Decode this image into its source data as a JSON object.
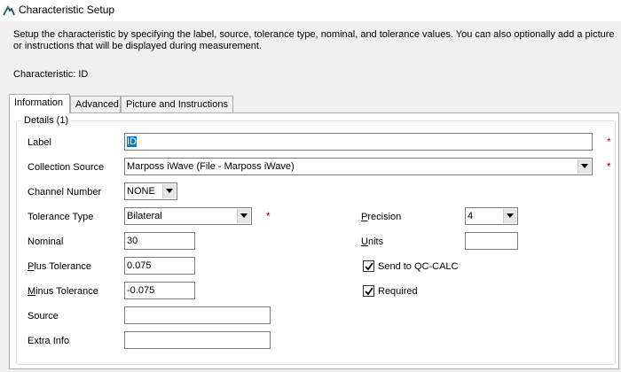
{
  "window": {
    "title": "Characteristic Setup"
  },
  "description": "Setup the characteristic by specifying the label, source, tolerance type, nominal, and tolerance values. You can also optionally add a picture or instructions that will be displayed during measurement.",
  "characteristic_line": "Characteristic: ID",
  "tabs": [
    {
      "label": "Information",
      "active": true
    },
    {
      "label": "Advanced",
      "active": false
    },
    {
      "label": "Picture and Instructions",
      "active": false
    }
  ],
  "details": {
    "group_label": "Details (1)",
    "label": {
      "caption": "Label",
      "value": "ID"
    },
    "collection_source": {
      "caption": "Collection Source",
      "value": "Marposs iWave (File - Marposs iWave)"
    },
    "channel_number": {
      "caption": "Channel Number",
      "value": "NONE"
    },
    "tolerance_type": {
      "caption": "Tolerance Type",
      "value": "Bilateral"
    },
    "nominal": {
      "caption": "Nominal",
      "value": "30"
    },
    "plus_tolerance": {
      "caption_first": "P",
      "caption_rest": "lus Tolerance",
      "value": "0.075"
    },
    "minus_tolerance": {
      "caption_first": "M",
      "caption_rest": "inus Tolerance",
      "value": "-0.075"
    },
    "source": {
      "caption": "Source",
      "value": ""
    },
    "extra_info": {
      "caption": "Extra Info",
      "value": ""
    },
    "precision": {
      "caption_first": "P",
      "caption_rest": "recision",
      "value": "4"
    },
    "units": {
      "caption_first": "U",
      "caption_rest": "nits",
      "value": ""
    },
    "send_to_qc_calc": {
      "caption": "Send to QC-CALC",
      "checked": true
    },
    "required": {
      "caption": "Required",
      "checked": true
    },
    "required_marker": "*"
  },
  "colors": {
    "required": "#d00000",
    "selection": "#0078d7"
  }
}
